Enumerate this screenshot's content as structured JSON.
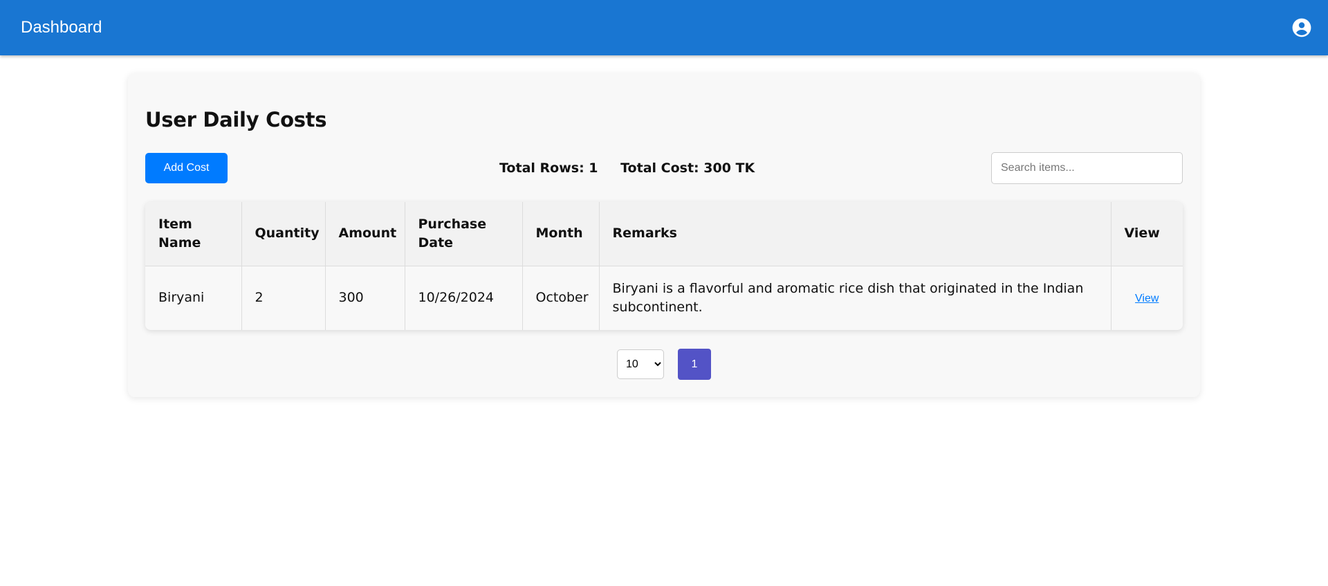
{
  "appbar": {
    "title": "Dashboard",
    "account_icon": "account-circle-icon",
    "color": "#1976d2"
  },
  "page": {
    "title": "User Daily Costs",
    "add_button_label": "Add Cost",
    "totals": {
      "rows_label": "Total Rows: 1",
      "cost_label": "Total Cost: 300 TK"
    },
    "search": {
      "placeholder": "Search items...",
      "value": ""
    }
  },
  "table": {
    "headers": [
      "Item Name",
      "Quantity",
      "Amount",
      "Purchase Date",
      "Month",
      "Remarks",
      "View"
    ],
    "rows": [
      {
        "item_name": "Biryani",
        "quantity": "2",
        "amount": "300",
        "purchase_date": "10/26/2024",
        "month": "October",
        "remarks": "Biryani is a flavorful and aromatic rice dish that originated in the Indian subcontinent.",
        "view_label": "View"
      }
    ]
  },
  "pagination": {
    "page_size": "10",
    "page_size_options": [
      "10"
    ],
    "current_page": "1"
  },
  "colors": {
    "primary_button": "#007bff",
    "page_button": "#5353c6",
    "link": "#007bff"
  }
}
